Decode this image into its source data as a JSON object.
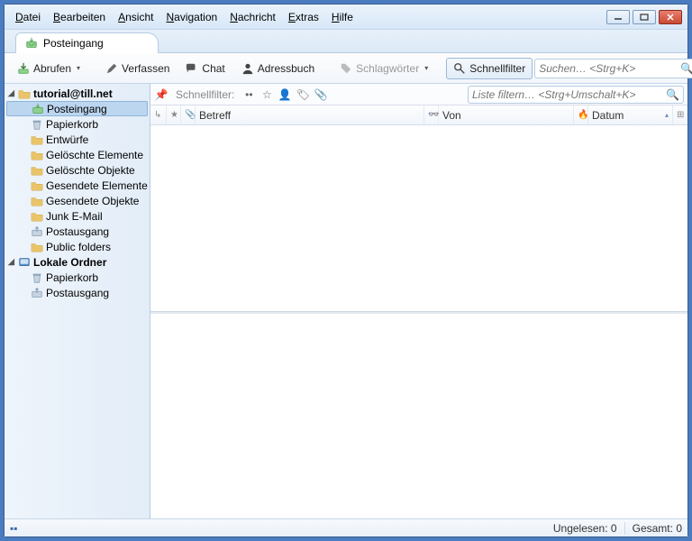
{
  "menu": {
    "items": [
      "Datei",
      "Bearbeiten",
      "Ansicht",
      "Navigation",
      "Nachricht",
      "Extras",
      "Hilfe"
    ]
  },
  "tab": {
    "label": "Posteingang"
  },
  "toolbar": {
    "fetch": "Abrufen",
    "compose": "Verfassen",
    "chat": "Chat",
    "addressbook": "Adressbuch",
    "tags": "Schlagwörter",
    "quickfilter": "Schnellfilter",
    "search_placeholder": "Suchen… <Strg+K>"
  },
  "filterbar": {
    "label": "Schnellfilter:",
    "filter_placeholder": "Liste filtern… <Strg+Umschalt+K>"
  },
  "columns": {
    "subject": "Betreff",
    "from": "Von",
    "date": "Datum"
  },
  "tree": {
    "account": "tutorial@till.net",
    "folders": [
      "Posteingang",
      "Papierkorb",
      "Entwürfe",
      "Gelöschte Elemente",
      "Gelöschte Objekte",
      "Gesendete Elemente",
      "Gesendete Objekte",
      "Junk E-Mail",
      "Postausgang",
      "Public folders"
    ],
    "local_label": "Lokale Ordner",
    "local_folders": [
      "Papierkorb",
      "Postausgang"
    ]
  },
  "status": {
    "unread_label": "Ungelesen:",
    "unread_value": "0",
    "total_label": "Gesamt:",
    "total_value": "0"
  }
}
